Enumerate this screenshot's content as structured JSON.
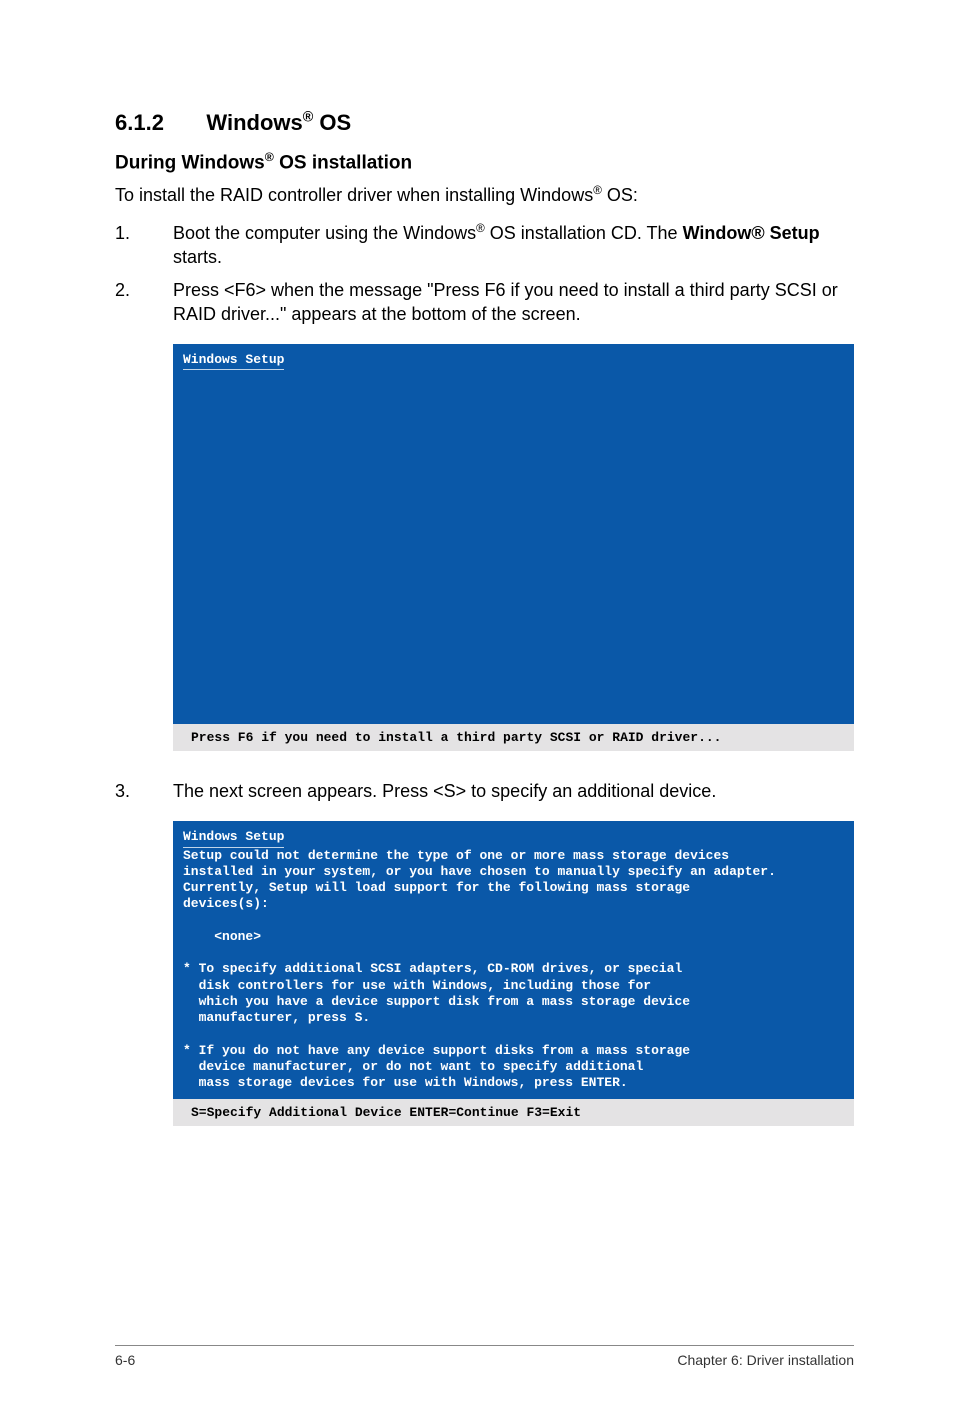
{
  "heading": {
    "number": "6.1.2",
    "title_pre": "Windows",
    "title_sup": "®",
    "title_post": " OS"
  },
  "subheading": {
    "pre": "During Windows",
    "sup": "®",
    "post": " OS installation"
  },
  "intro": {
    "pre": "To install the RAID controller driver when installing Windows",
    "sup": "®",
    "post": " OS:"
  },
  "steps": {
    "s1": {
      "num": "1.",
      "pre": "Boot the computer using the Windows",
      "sup": "®",
      "mid": " OS installation CD. The ",
      "bold": "Window® Setup",
      "post": " starts."
    },
    "s2": {
      "num": "2.",
      "text": "Press <F6> when the message \"Press F6 if you need to install a third party SCSI or RAID driver...\" appears at the bottom of the screen."
    },
    "s3": {
      "num": "3.",
      "text": "The next screen appears. Press <S> to specify an additional device."
    }
  },
  "screen1": {
    "title": "Windows Setup",
    "grey": "Press F6 if you need to install a third party SCSI or RAID driver..."
  },
  "screen2": {
    "title": "Windows Setup",
    "body": "\nSetup could not determine the type of one or more mass storage devices\ninstalled in your system, or you have chosen to manually specify an adapter.\nCurrently, Setup will load support for the following mass storage\ndevices(s):\n\n    <none>\n\n* To specify additional SCSI adapters, CD-ROM drives, or special\n  disk controllers for use with Windows, including those for\n  which you have a device support disk from a mass storage device\n  manufacturer, press S.\n\n* If you do not have any device support disks from a mass storage\n  device manufacturer, or do not want to specify additional\n  mass storage devices for use with Windows, press ENTER.\n",
    "grey": "S=Specify Additional Device   ENTER=Continue   F3=Exit"
  },
  "footer": {
    "left": "6-6",
    "right": "Chapter 6: Driver installation"
  }
}
